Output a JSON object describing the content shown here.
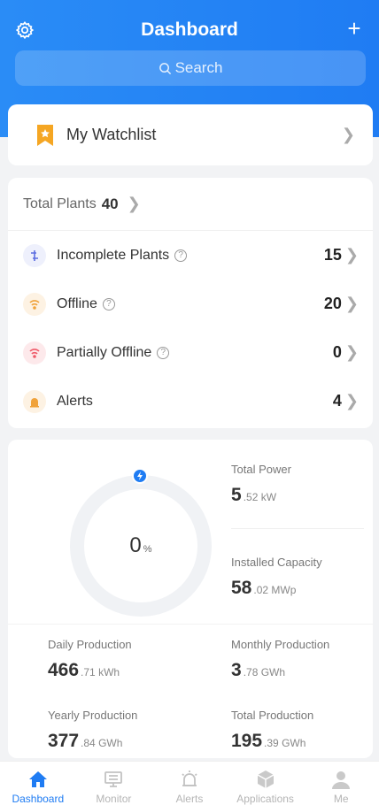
{
  "header": {
    "title": "Dashboard",
    "search_placeholder": "Search"
  },
  "watchlist": {
    "label": "My Watchlist"
  },
  "plants": {
    "total_label": "Total Plants",
    "total_value": "40",
    "rows": [
      {
        "label": "Incomplete Plants",
        "value": "15",
        "color": "#5b6de0"
      },
      {
        "label": "Offline",
        "value": "20",
        "color": "#f0a23a"
      },
      {
        "label": "Partially Offline",
        "value": "0",
        "color": "#ef5b6a"
      },
      {
        "label": "Alerts",
        "value": "4",
        "color": "#f0a23a"
      }
    ]
  },
  "stats": {
    "ring": {
      "percent": "0",
      "unit": "%",
      "fraction": 0
    },
    "total_power": {
      "label": "Total Power",
      "big": "5",
      "small": ".52 kW"
    },
    "installed_capacity": {
      "label": "Installed Capacity",
      "big": "58",
      "small": ".02 MWp"
    },
    "daily": {
      "label": "Daily Production",
      "big": "466",
      "small": ".71 kWh"
    },
    "monthly": {
      "label": "Monthly Production",
      "big": "3",
      "small": ".78 GWh"
    },
    "yearly": {
      "label": "Yearly Production",
      "big": "377",
      "small": ".84 GWh"
    },
    "total": {
      "label": "Total Production",
      "big": "195",
      "small": ".39 GWh"
    }
  },
  "tabs": [
    {
      "label": "Dashboard",
      "icon": "home-icon",
      "active": true
    },
    {
      "label": "Monitor",
      "icon": "monitor-icon",
      "active": false
    },
    {
      "label": "Alerts",
      "icon": "alarm-icon",
      "active": false
    },
    {
      "label": "Applications",
      "icon": "cube-icon",
      "active": false
    },
    {
      "label": "Me",
      "icon": "user-icon",
      "active": false
    }
  ],
  "colors": {
    "primary": "#1f7cf3",
    "watch_icon": "#f5a623"
  }
}
